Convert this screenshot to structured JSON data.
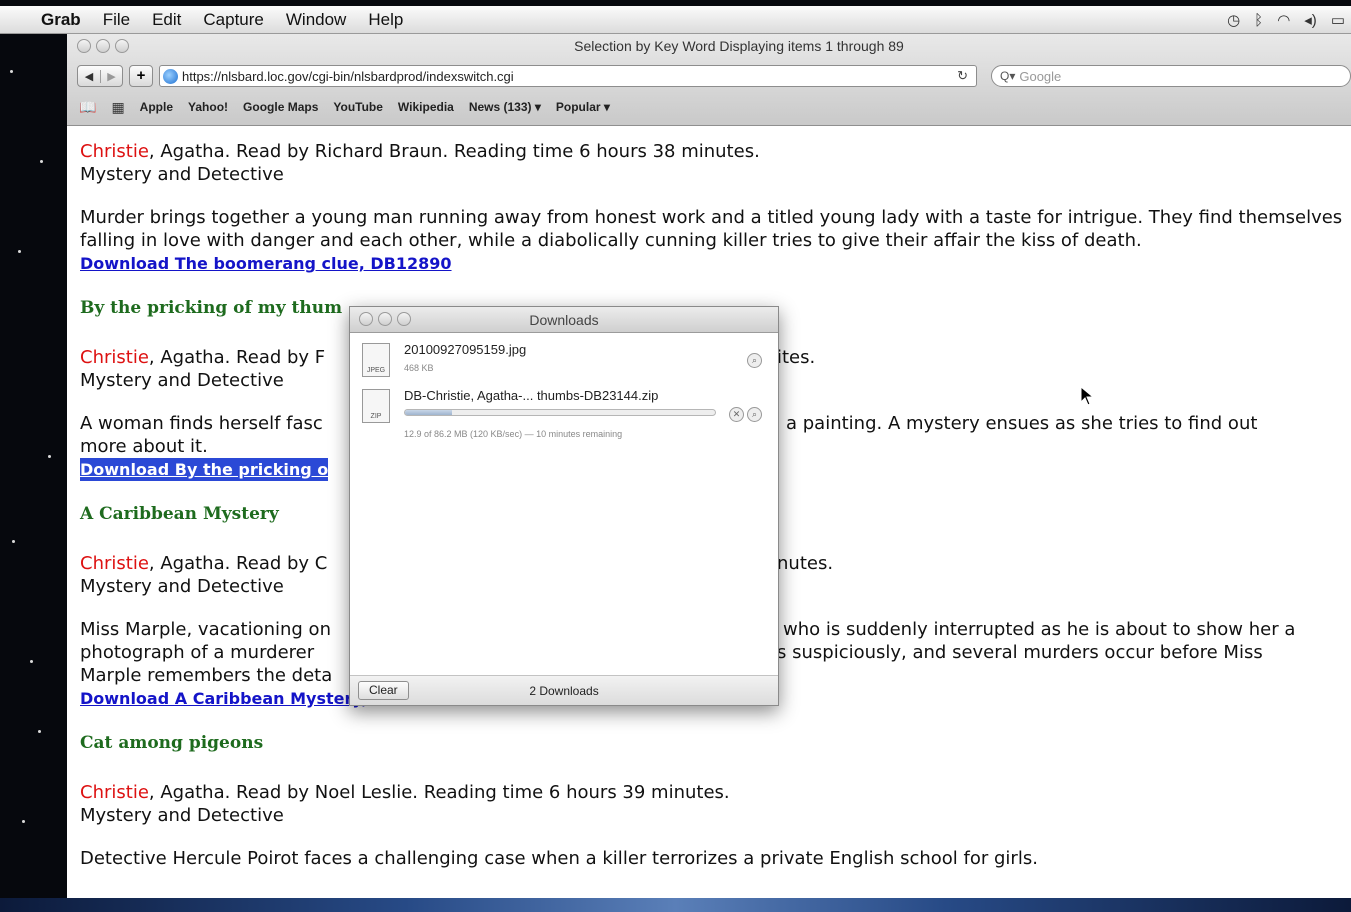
{
  "menubar": {
    "apple_icon": "",
    "items": [
      "Grab",
      "File",
      "Edit",
      "Capture",
      "Window",
      "Help"
    ]
  },
  "browser": {
    "window_title": "Selection by Key Word Displaying items 1 through 89",
    "url": "https://nlsbard.loc.gov/cgi-bin/nlsbardprod/indexswitch.cgi",
    "search_placeholder": "Google",
    "bookmarks": [
      "Apple",
      "Yahoo!",
      "Google Maps",
      "YouTube",
      "Wikipedia",
      "News (133) ▾",
      "Popular ▾"
    ]
  },
  "content": {
    "entries": [
      {
        "author": "Christie",
        "read_by": ", Agatha. Read by Richard Braun. Reading time 6 hours 38 minutes.",
        "category": "Mystery and Detective",
        "description": "Murder brings together a young man running away from honest work and a titled young lady with a taste for intrigue. They find themselves falling in love with danger and each other, while a diabolically cunning killer tries to give their affair the kiss of death.",
        "download": "Download The boomerang clue, DB12890"
      },
      {
        "title": "By the pricking of my thum",
        "author": "Christie",
        "read_by": ", Agatha. Read by F",
        "read_by_tail": "ites.",
        "category": "Mystery and Detective",
        "description": "A woman finds herself fasc",
        "description_tail": "a painting. A mystery ensues as she tries to find out",
        "description_line2": "more about it.",
        "download": "Download By the pricking o"
      },
      {
        "title": "A Caribbean Mystery",
        "author": "Christie",
        "read_by": ", Agatha. Read by C",
        "read_by_tail": "nutes.",
        "category": "Mystery and Detective",
        "description": "Miss Marple, vacationing on",
        "description_tail": "who is suddenly interrupted as he is about to show her a",
        "description_line2": "photograph of a murderer",
        "description_line2_tail": "s suspiciously, and several murders occur before Miss",
        "description_line3": "Marple remembers the deta",
        "download": "Download A Caribbean Mystery, DB44500"
      },
      {
        "title": "Cat among pigeons",
        "author": "Christie",
        "read_by": ", Agatha. Read by Noel Leslie. Reading time 6 hours 39 minutes.",
        "category": "Mystery and Detective",
        "description": "Detective Hercule Poirot faces a challenging case when a killer terrorizes a private English school for girls."
      }
    ]
  },
  "downloads": {
    "title": "Downloads",
    "items": [
      {
        "name": "20100927095159.jpg",
        "meta": "468 KB",
        "icon": "jpeg-file-icon",
        "icon_text": "JPEG"
      },
      {
        "name": "DB-Christie, Agatha-... thumbs-DB23144.zip",
        "meta": "12.9 of 86.2 MB (120 KB/sec) — 10 minutes remaining",
        "icon": "zip-file-icon",
        "icon_text": "ZIP",
        "progress": 0.15
      }
    ],
    "clear_label": "Clear",
    "count_label": "2 Downloads"
  }
}
